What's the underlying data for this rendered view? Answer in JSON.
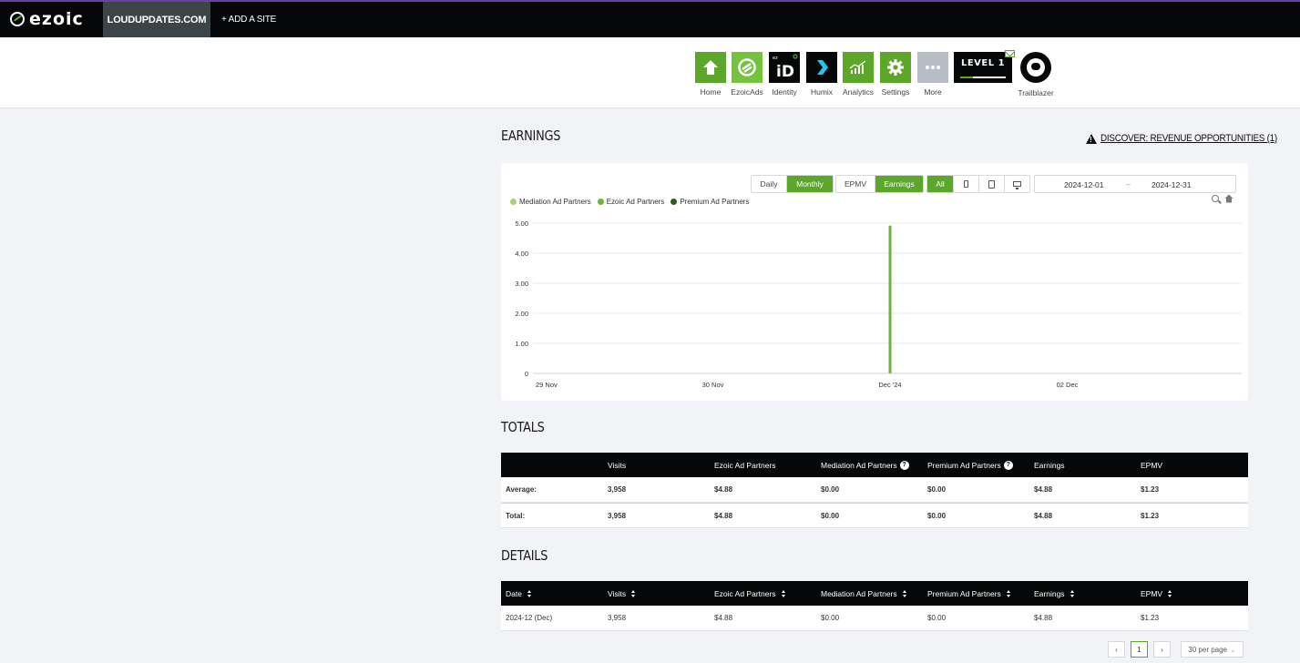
{
  "topbar": {
    "logo": "ezoic",
    "site": "LOUDUPDATES.COM",
    "add_site": "+ ADD A SITE"
  },
  "nav": {
    "home": "Home",
    "ezoicads": "EzoicAds",
    "identity": "Identity",
    "humix": "Humix",
    "analytics": "Analytics",
    "settings": "Settings",
    "more": "More",
    "level": "LEVEL 1",
    "trailblazer": "Trailblazer"
  },
  "earnings": {
    "title": "EARNINGS",
    "discover": "DISCOVER: REVENUE OPPORTUNITIES (1)"
  },
  "controls": {
    "daily": "Daily",
    "monthly": "Monthly",
    "epmv": "EPMV",
    "earnings": "Earnings",
    "all": "All",
    "date_from": "2024-12-01",
    "date_sep": "–",
    "date_to": "2024-12-31"
  },
  "colors": {
    "accent": "#5ca62a",
    "mediation": "#a5d07c",
    "ezoic": "#6db33f",
    "premium": "#2c5e1a"
  },
  "chart_data": {
    "type": "bar",
    "legend": [
      "Mediation Ad Partners",
      "Ezoic Ad Partners",
      "Premium Ad Partners"
    ],
    "x_tick_labels": [
      "29 Nov",
      "30 Nov",
      "Dec '24",
      "02 Dec"
    ],
    "y_tick_labels": [
      "0",
      "1.00",
      "2.00",
      "3.00",
      "4.00",
      "5.00"
    ],
    "ylim": [
      0,
      5
    ],
    "categories": [
      "Dec '24"
    ],
    "series": [
      {
        "name": "Mediation Ad Partners",
        "values": [
          0
        ]
      },
      {
        "name": "Ezoic Ad Partners",
        "values": [
          4.88
        ]
      },
      {
        "name": "Premium Ad Partners",
        "values": [
          0
        ]
      }
    ],
    "grid": true,
    "legend_position": "top-left"
  },
  "totals": {
    "title": "TOTALS",
    "headers": [
      "",
      "Visits",
      "Ezoic Ad Partners",
      "Mediation Ad Partners",
      "Premium Ad Partners",
      "Earnings",
      "EPMV"
    ],
    "rows": [
      [
        "Average:",
        "3,958",
        "$4.88",
        "$0.00",
        "$0.00",
        "$4.88",
        "$1.23"
      ],
      [
        "Total:",
        "3,958",
        "$4.88",
        "$0.00",
        "$0.00",
        "$4.88",
        "$1.23"
      ]
    ]
  },
  "details": {
    "title": "DETAILS",
    "headers": [
      "Date",
      "Visits",
      "Ezoic Ad Partners",
      "Mediation Ad Partners",
      "Premium Ad Partners",
      "Earnings",
      "EPMV"
    ],
    "rows": [
      [
        "2024-12 (Dec)",
        "3,958",
        "$4.88",
        "$0.00",
        "$0.00",
        "$4.88",
        "$1.23"
      ]
    ],
    "pagination": {
      "prev": "‹",
      "page": "1",
      "next": "›",
      "per_page": "30 per page"
    }
  }
}
